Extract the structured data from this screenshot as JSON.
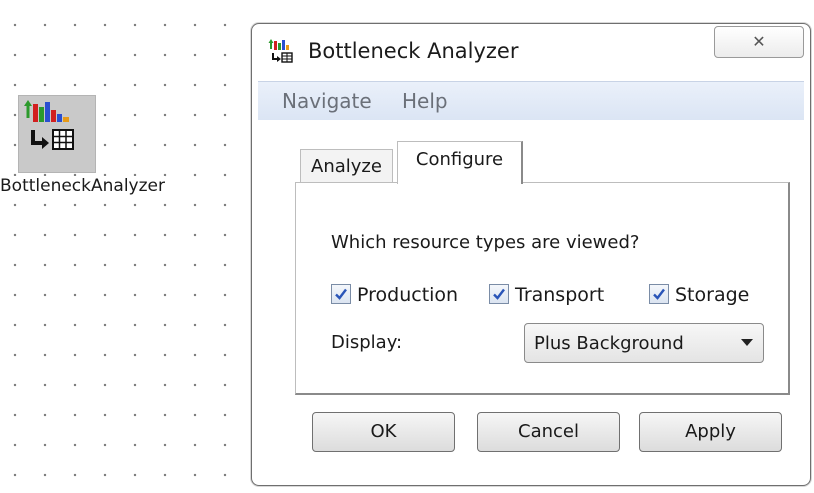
{
  "desktop": {
    "block_label": "BottleneckAnalyzer",
    "block_icon": "bottleneck-analyzer-icon"
  },
  "window": {
    "title": "Bottleneck Analyzer",
    "title_icon": "bottleneck-analyzer-icon",
    "close_glyph": "✕"
  },
  "menu": {
    "items": [
      "Navigate",
      "Help"
    ]
  },
  "tabs": [
    {
      "label": "Analyze",
      "selected": false
    },
    {
      "label": "Configure",
      "selected": true
    }
  ],
  "configure": {
    "question": "Which resource types are viewed?",
    "checkboxes": [
      {
        "label": "Production",
        "checked": true
      },
      {
        "label": "Transport",
        "checked": true
      },
      {
        "label": "Storage",
        "checked": true
      }
    ],
    "display_label": "Display:",
    "display_value": "Plus Background"
  },
  "buttons": {
    "ok": "OK",
    "cancel": "Cancel",
    "apply": "Apply"
  },
  "colors": {
    "menubar": "#dbe5f4",
    "menu_text": "#6b7079",
    "check": "#2a55b8",
    "chart_red": "#d21f1f",
    "chart_green": "#2c9a2c",
    "chart_blue": "#2a4fd0",
    "chart_orange": "#e79a18"
  }
}
